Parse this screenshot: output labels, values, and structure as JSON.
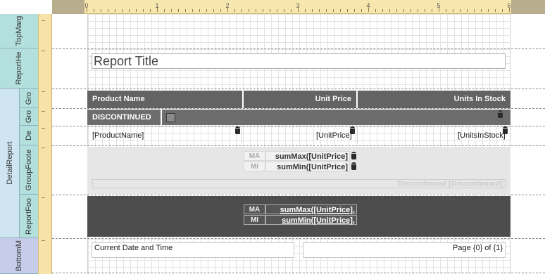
{
  "ruler": {
    "marks": [
      "0",
      "1",
      "2",
      "3",
      "4",
      "5",
      "6"
    ]
  },
  "bands": {
    "top_margin": "TopMarg",
    "report_header": "ReportHe",
    "detail_report": "DetailReport",
    "group_header1": "Gro",
    "group_header2": "Gro",
    "detail": "De",
    "group_footer": "GroupFoote",
    "report_footer": "ReportFoo",
    "bottom_margin": "BottomM"
  },
  "report_header": {
    "title": "Report Title"
  },
  "group_header": {
    "col1": "Product Name",
    "col2": "Unit Price",
    "col3": "Units In Stock",
    "discontinued": "DISCONTINUED"
  },
  "detail": {
    "field1": "[ProductName]",
    "field2": "[UnitPrice]",
    "field3": "[UnitsInStock]"
  },
  "group_footer": {
    "max_label": "MA",
    "max_expr": "sumMax([UnitPrice]",
    "min_label": "MI",
    "min_expr": "sumMin([UnitPrice]",
    "discontinued_caption": "Discontinued [Discontinued]"
  },
  "report_footer": {
    "max_label": "MA",
    "max_expr": "sumMax([UnitPrice],",
    "min_label": "MI",
    "min_expr": "sumMin([UnitPrice],"
  },
  "bottom_margin": {
    "datetime": "Current Date and Time",
    "page_info": "Page {0} of {1}"
  },
  "colors": {
    "band_teal": "#b3e0dc",
    "band_lightblue": "#cfe6f2",
    "band_violet": "#c6cce9",
    "ruler": "#f7e6ad",
    "header_dark": "#636363",
    "footer_dark": "#4d4d4d"
  }
}
